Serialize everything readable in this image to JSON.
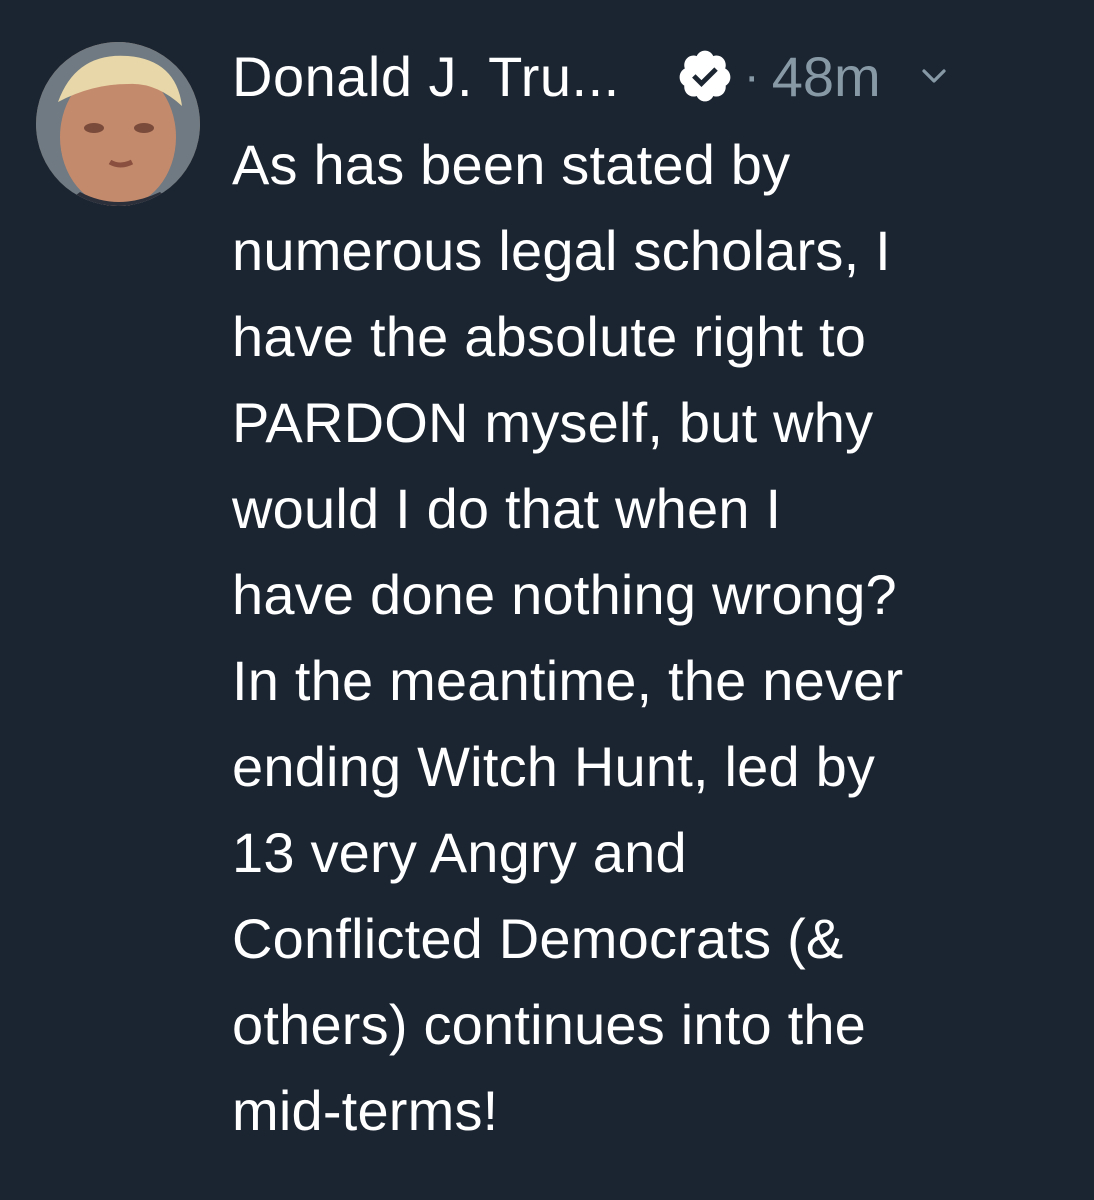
{
  "tweet": {
    "author_name": "Donald J. Tru...",
    "time": "48m",
    "separator": "·",
    "text_lines": [
      "As has been stated by",
      "numerous legal scholars, I",
      "have the absolute right to",
      "PARDON myself, but why",
      "would I do that when I",
      "have done nothing wrong?",
      "In the meantime, the never",
      "ending Witch Hunt, led by",
      "13 very Angry and",
      "Conflicted Democrats (&",
      "others) continues into the",
      "mid-terms!"
    ]
  },
  "icons": {
    "avatar": "avatar-photo",
    "verified": "verified-badge-icon",
    "menu": "chevron-down-icon"
  },
  "colors": {
    "background": "#1b2532",
    "text": "#ffffff",
    "muted": "#8899a6"
  }
}
